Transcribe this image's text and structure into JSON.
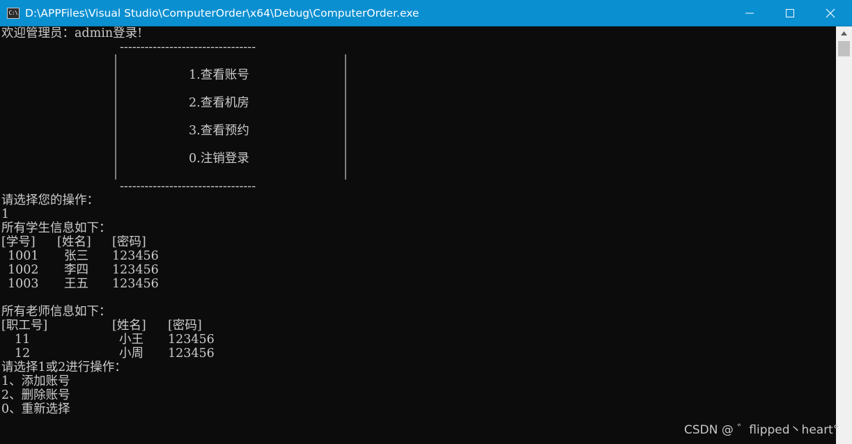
{
  "window": {
    "title": "D:\\APPFiles\\Visual Studio\\ComputerOrder\\x64\\Debug\\ComputerOrder.exe",
    "icon_label": "C:\\",
    "icon": "console-app-icon",
    "controls": [
      "minimize-icon",
      "maximize-icon",
      "close-icon"
    ]
  },
  "console": {
    "welcome": "欢迎管理员：admin登录!",
    "dash_line": "---------------------------------",
    "menu": {
      "item1": "1.查看账号",
      "item2": "2.查看机房",
      "item3": "3.查看预约",
      "item0": "0.注销登录"
    },
    "prompt": "请选择您的操作：",
    "input": "1",
    "students": {
      "heading": "所有学生信息如下：",
      "headers": [
        "[学号]",
        "[姓名]",
        "[密码]"
      ],
      "rows": [
        [
          "1001",
          "张三",
          "123456"
        ],
        [
          "1002",
          "李四",
          "123456"
        ],
        [
          "1003",
          "王五",
          "123456"
        ]
      ]
    },
    "teachers": {
      "heading": "所有老师信息如下：",
      "headers": [
        "[职工号]",
        "[姓名]",
        "[密码]"
      ],
      "rows": [
        [
          "11",
          "小王",
          "123456"
        ],
        [
          "12",
          "小周",
          "123456"
        ]
      ]
    },
    "choice_prompt": "请选择1或2进行操作：",
    "options": [
      "1、添加账号",
      "2、删除账号",
      "0、重新选择"
    ]
  },
  "watermark": "CSDN @ ゛flipped丶heart°",
  "colors": {
    "titlebar": "#0a8fd1",
    "console_bg": "#0c0c0c",
    "console_text": "#cccccc",
    "scrollbar_bg": "#f0f0f0"
  }
}
